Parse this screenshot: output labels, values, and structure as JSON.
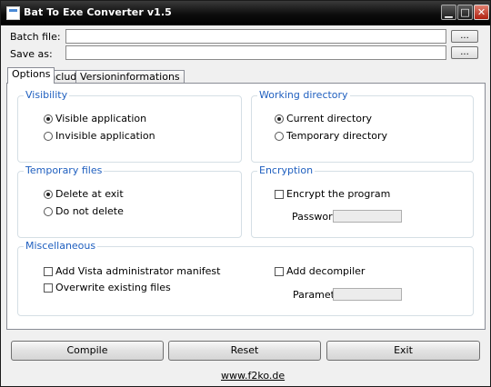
{
  "window": {
    "title": "Bat To Exe Converter v1.5",
    "controls": {
      "minimize": "▁",
      "maximize": "□",
      "close": "✕"
    }
  },
  "files": {
    "batch_label": "Batch file:",
    "batch_value": "",
    "save_label": "Save as:",
    "save_value": "",
    "browse_label": "..."
  },
  "tabs": [
    {
      "label": "Options",
      "active": true
    },
    {
      "label": "Include",
      "active": false
    },
    {
      "label": "Versioninformations",
      "active": false
    }
  ],
  "visibility": {
    "title": "Visibility",
    "visible": "Visible application",
    "invisible": "Invisible application",
    "selected": "visible"
  },
  "working_directory": {
    "title": "Working directory",
    "current": "Current directory",
    "temporary": "Temporary directory",
    "selected": "current"
  },
  "temporary_files": {
    "title": "Temporary files",
    "delete": "Delete at exit",
    "keep": "Do not delete",
    "selected": "delete"
  },
  "encryption": {
    "title": "Encryption",
    "encrypt_label": "Encrypt the program",
    "encrypt_checked": false,
    "password_label": "Password:",
    "password_value": ""
  },
  "misc": {
    "title": "Miscellaneous",
    "vista_manifest": "Add Vista administrator manifest",
    "overwrite": "Overwrite existing files",
    "decompiler": "Add decompiler",
    "parameter_label": "Parameter:",
    "parameter_value": ""
  },
  "buttons": {
    "compile": "Compile",
    "reset": "Reset",
    "exit": "Exit"
  },
  "footer": {
    "link": "www.f2ko.de"
  }
}
